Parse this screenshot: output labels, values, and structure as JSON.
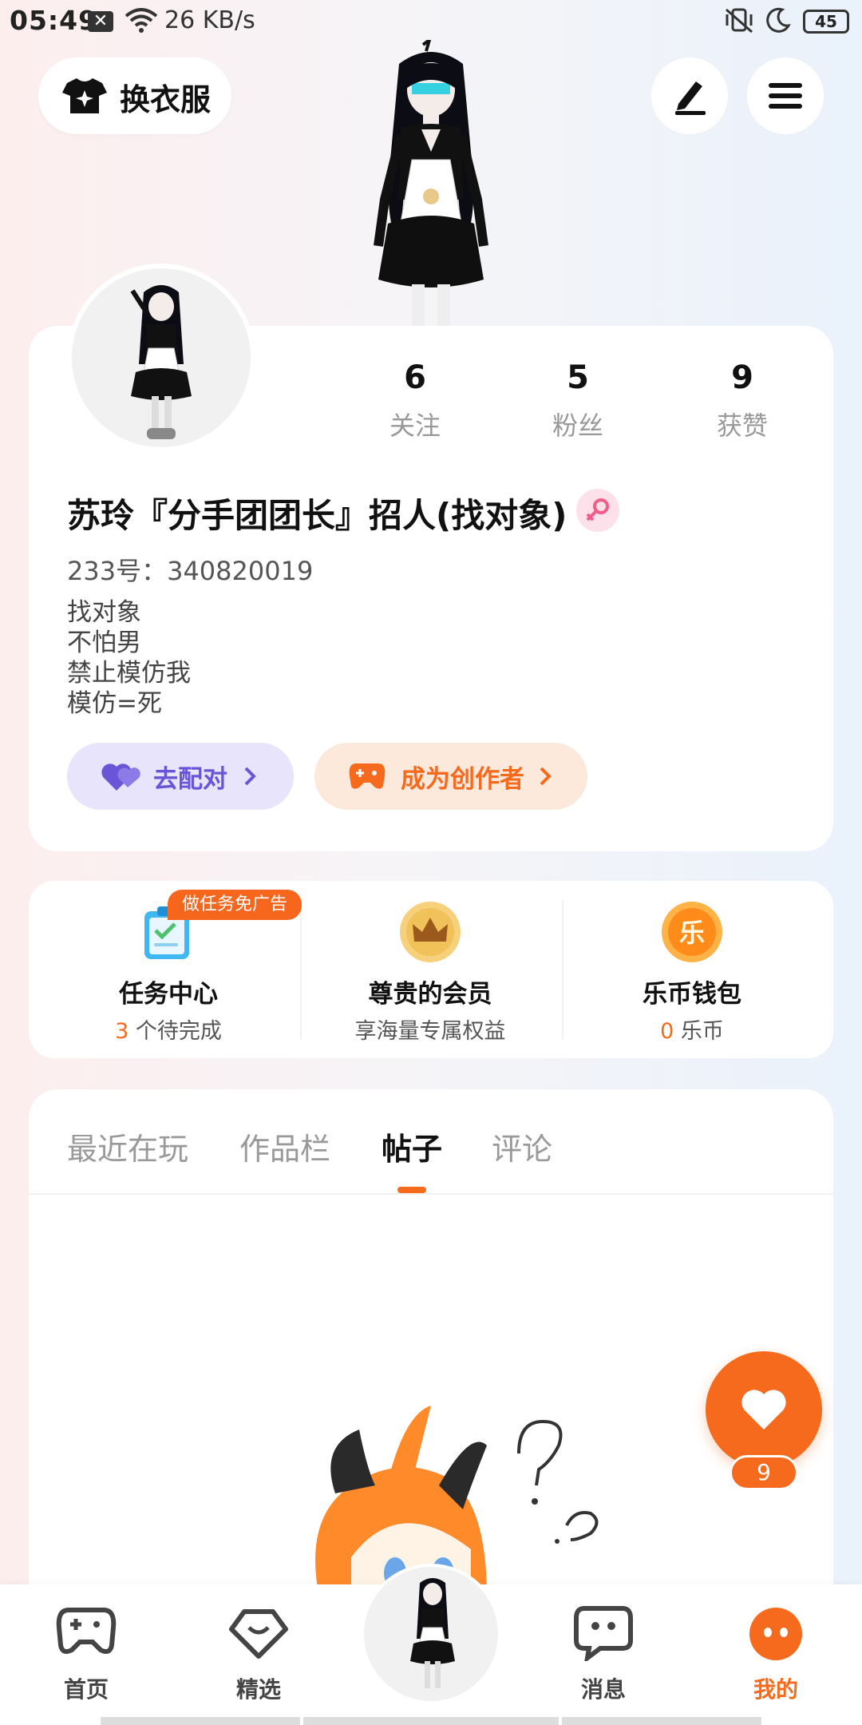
{
  "status_bar": {
    "time": "05:49",
    "net_speed": "26 KB/s",
    "battery": "45"
  },
  "top": {
    "change_clothes": "换衣服",
    "edit_icon": "pencil-icon",
    "menu_icon": "hamburger-menu-icon"
  },
  "profile": {
    "stats": [
      {
        "value": "6",
        "label": "关注"
      },
      {
        "value": "5",
        "label": "粉丝"
      },
      {
        "value": "9",
        "label": "获赞"
      }
    ],
    "username": "苏玲『分手团团长』招人(找对象)",
    "uid": "233号：340820019",
    "bio": [
      "找对象",
      "不怕男",
      "禁止模仿我",
      "模仿=死"
    ],
    "match_button": "去配对",
    "creator_button": "成为创作者"
  },
  "features": {
    "task_badge": "做任务免广告",
    "task": {
      "title": "任务中心",
      "count": "3",
      "suffix": " 个待完成"
    },
    "vip": {
      "title": "尊贵的会员",
      "sub": "享海量专属权益"
    },
    "wallet": {
      "title": "乐币钱包",
      "count": "0",
      "suffix": " 乐币",
      "icon_char": "乐"
    }
  },
  "tabs": [
    "最近在玩",
    "作品栏",
    "帖子",
    "评论"
  ],
  "active_tab": "帖子",
  "like_fab": {
    "count": "9"
  },
  "nav": [
    "首页",
    "精选",
    "消息",
    "我的"
  ],
  "colors": {
    "accent": "#f56a1c",
    "purple": "#6a55d8"
  }
}
